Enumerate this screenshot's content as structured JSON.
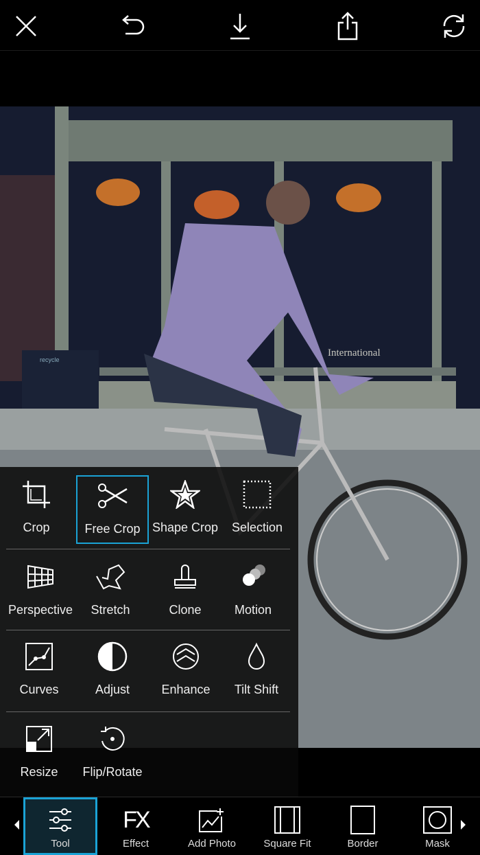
{
  "topbar": {
    "icons": [
      "close-icon",
      "undo-icon",
      "download-icon",
      "share-icon",
      "sync-icon"
    ]
  },
  "tools": {
    "rows": [
      [
        {
          "label": "Crop",
          "icon": "crop-icon"
        },
        {
          "label": "Free Crop",
          "icon": "scissors-icon",
          "selected": true
        },
        {
          "label": "Shape Crop",
          "icon": "star-icon"
        },
        {
          "label": "Selection",
          "icon": "selection-icon"
        }
      ],
      [
        {
          "label": "Perspective",
          "icon": "perspective-icon"
        },
        {
          "label": "Stretch",
          "icon": "stretch-icon"
        },
        {
          "label": "Clone",
          "icon": "stamp-icon"
        },
        {
          "label": "Motion",
          "icon": "motion-icon"
        }
      ],
      [
        {
          "label": "Curves",
          "icon": "curves-icon"
        },
        {
          "label": "Adjust",
          "icon": "adjust-icon"
        },
        {
          "label": "Enhance",
          "icon": "enhance-icon"
        },
        {
          "label": "Tilt Shift",
          "icon": "drop-icon"
        }
      ],
      [
        {
          "label": "Resize",
          "icon": "resize-icon"
        },
        {
          "label": "Flip/Rotate",
          "icon": "rotate-icon"
        }
      ]
    ]
  },
  "bottom_nav": {
    "items": [
      {
        "label": "Tool",
        "active": true
      },
      {
        "label": "Effect"
      },
      {
        "label": "Add Photo"
      },
      {
        "label": "Square Fit"
      },
      {
        "label": "Border"
      },
      {
        "label": "Mask"
      }
    ],
    "effect_glyph": "FX"
  },
  "photo": {
    "sign_text": "International",
    "bin_text": "recycle"
  },
  "colors": {
    "accent": "#1aa3d6"
  }
}
